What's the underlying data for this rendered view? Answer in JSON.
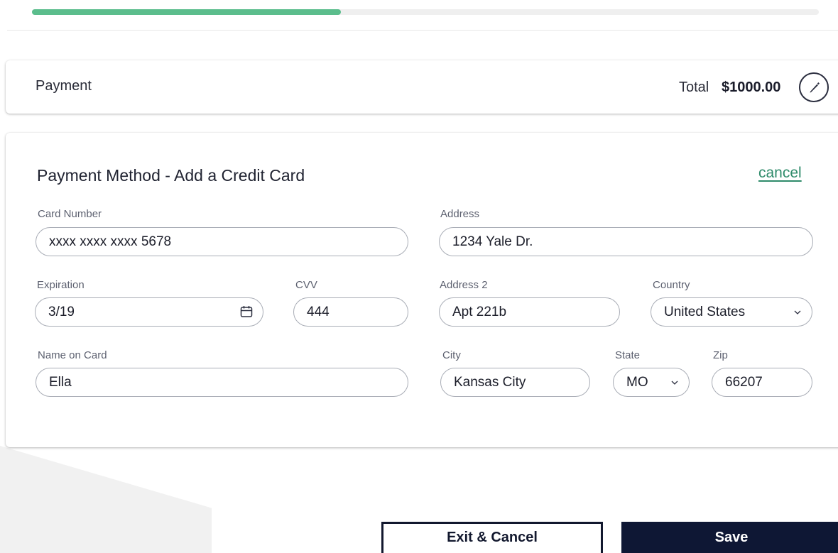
{
  "progress": {
    "value_fraction": 0.393,
    "color": "#5bbd8c"
  },
  "summary": {
    "label": "Payment",
    "total_label": "Total",
    "total_value": "$1000.00",
    "edit_icon": "pencil-icon"
  },
  "form": {
    "title": "Payment Method - Add a Credit Card",
    "cancel_label": "cancel",
    "card_number": {
      "label": "Card Number",
      "value": "xxxx xxxx xxxx 5678"
    },
    "expiration": {
      "label": "Expiration",
      "value": "3/19",
      "icon": "calendar-icon"
    },
    "cvv": {
      "label": "CVV",
      "value": "444"
    },
    "name_on_card": {
      "label": "Name on Card",
      "value": "Ella"
    },
    "address": {
      "label": "Address",
      "value": "1234 Yale Dr."
    },
    "address2": {
      "label": "Address 2",
      "value": "Apt 221b"
    },
    "country": {
      "label": "Country",
      "value": "United States",
      "icon": "chevron-down-icon"
    },
    "city": {
      "label": "City",
      "value": "Kansas City"
    },
    "state": {
      "label": "State",
      "value": "MO",
      "icon": "chevron-down-icon"
    },
    "zip": {
      "label": "Zip",
      "value": "66207"
    }
  },
  "actions": {
    "exit_label": "Exit & Cancel",
    "save_label": "Save"
  },
  "colors": {
    "accent": "#5bbd8c",
    "link": "#2e8b6a",
    "primary_button": "#0e1734"
  }
}
